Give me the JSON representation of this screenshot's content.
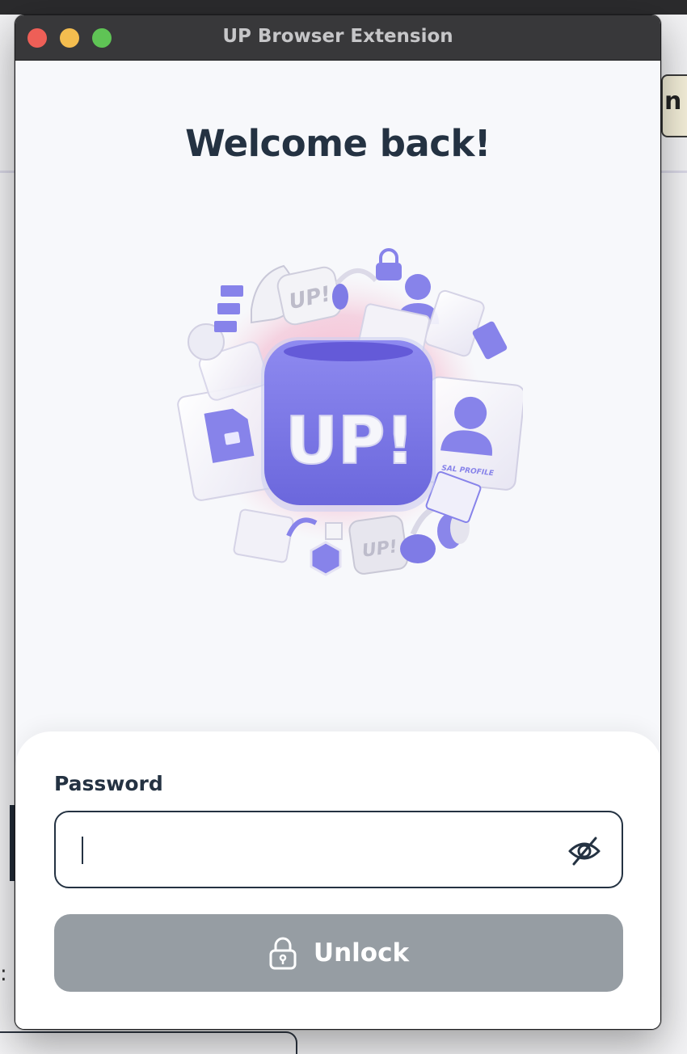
{
  "window": {
    "title": "UP Browser Extension"
  },
  "background": {
    "right_button_fragment": "n",
    "left_glyph_fragment": ":"
  },
  "main": {
    "heading": "Welcome back!",
    "illustration": {
      "cube_label": "UP!",
      "badge_label": "UP!",
      "small_tile_label": "UP!",
      "card_label": "SAL PROFILE"
    }
  },
  "form": {
    "password_label": "Password",
    "password_value": "",
    "password_placeholder": "",
    "unlock_label": "Unlock"
  },
  "icons": {
    "visibility_toggle": "eye-off-icon",
    "unlock": "lock-icon"
  },
  "colors": {
    "heading": "#243242",
    "cube": "#7b77e6",
    "unlock_button_disabled": "#969da3",
    "window_chrome": "#38383a"
  }
}
